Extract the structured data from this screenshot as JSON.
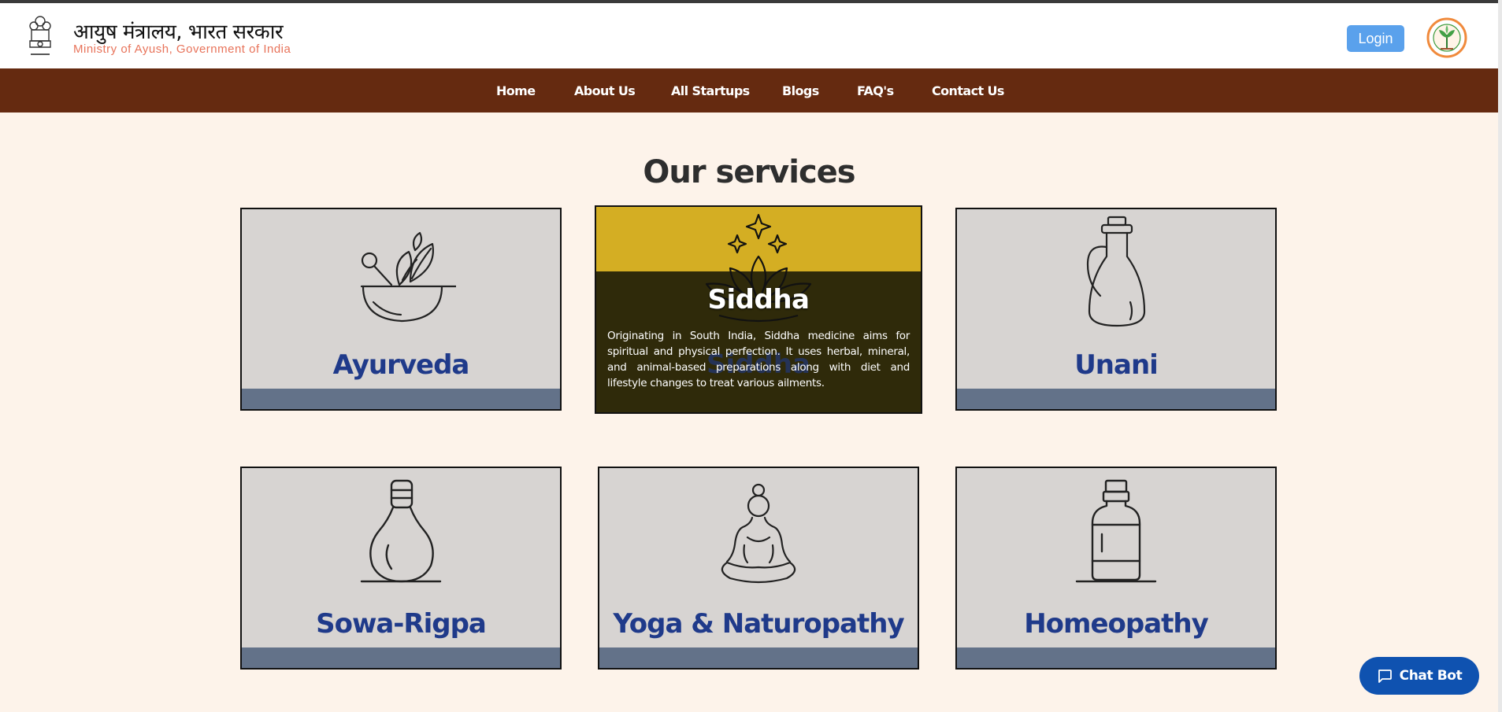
{
  "header": {
    "title_hindi": "आयुष मंत्रालय, भारत सरकार",
    "title_english": "Ministry of Ayush, Government of India",
    "login_label": "Login",
    "emblem_icon": "national-emblem-icon",
    "partner_logo_icon": "national-ayush-mission-logo-icon"
  },
  "nav": {
    "items": [
      {
        "label": "Home"
      },
      {
        "label": "About Us"
      },
      {
        "label": "All Startups"
      },
      {
        "label": "Blogs"
      },
      {
        "label": "FAQ's"
      },
      {
        "label": "Contact Us"
      }
    ]
  },
  "services": {
    "title": "Our services",
    "cards": [
      {
        "name": "Ayurveda",
        "icon": "mortar-pestle-leaves-icon"
      },
      {
        "name": "Siddha",
        "icon": "lotus-sparkles-icon",
        "description": "Originating in South India, Siddha medicine aims for spiritual and physical perfection. It uses herbal, mineral, and animal-based preparations along with diet and lifestyle changes to treat various ailments."
      },
      {
        "name": "Unani",
        "icon": "oil-flask-icon"
      },
      {
        "name": "Sowa-Rigpa",
        "icon": "herbal-compress-icon"
      },
      {
        "name": "Yoga & Naturopathy",
        "icon": "meditation-pose-icon"
      },
      {
        "name": "Homeopathy",
        "icon": "medicine-bottle-icon"
      }
    ]
  },
  "chatbot": {
    "label": "Chat Bot",
    "icon": "chat-bubble-icon"
  },
  "colors": {
    "nav_bg": "#652a10",
    "page_bg": "#fdf3ea",
    "card_bg": "#d7d4d2",
    "card_bar": "#637289",
    "card_title": "#1f3a8a",
    "active_band": "#d4ae23",
    "active_bg": "#2f2a0a",
    "chatbot_bg": "#0f52b0",
    "login_bg": "#5aa1ec"
  }
}
